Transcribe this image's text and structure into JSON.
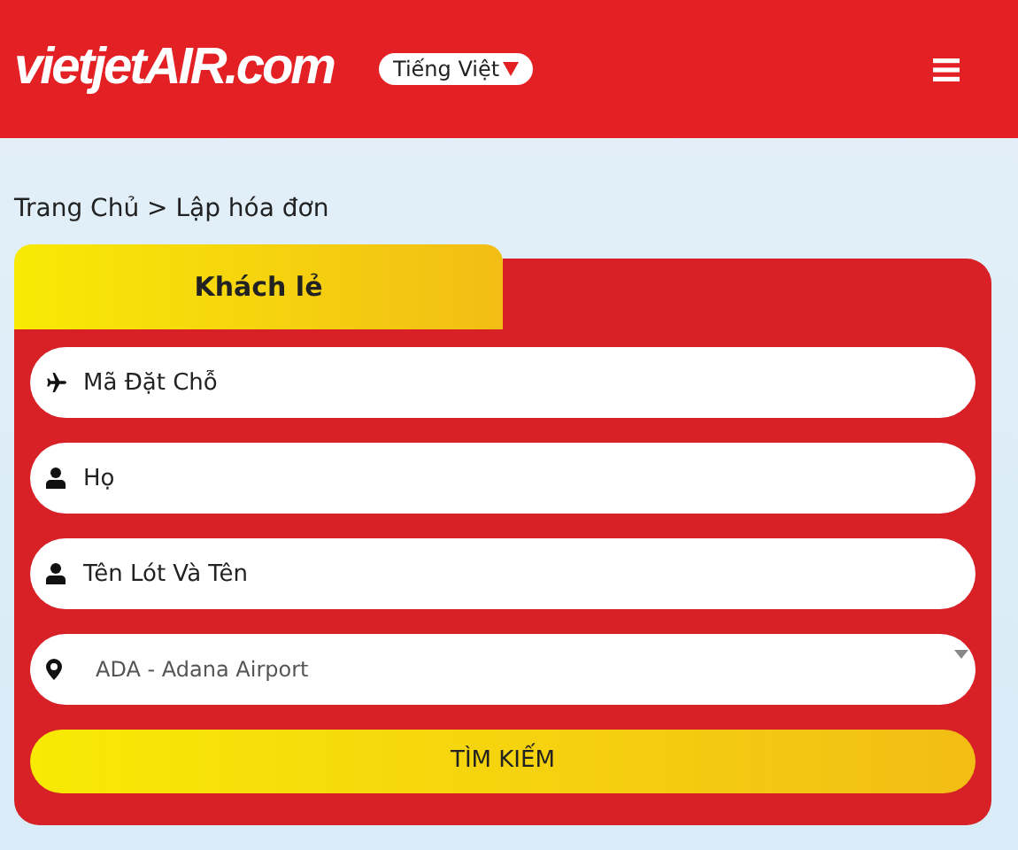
{
  "header": {
    "logo": "vietjetAIR.com",
    "language": "Tiếng Việt"
  },
  "breadcrumb": "Trang Chủ > Lập hóa đơn",
  "tabs": [
    {
      "label": "Khách lẻ",
      "selected": true
    }
  ],
  "fields": [
    {
      "kind": "plane",
      "placeholder": "Mã Đặt Chỗ"
    },
    {
      "kind": "user",
      "placeholder": "Họ"
    },
    {
      "kind": "user",
      "placeholder": "Tên Lót Và Tên"
    }
  ],
  "airport_select": {
    "value": "ADA - Adana Airport"
  },
  "search_button": "TÌM KIẾM"
}
